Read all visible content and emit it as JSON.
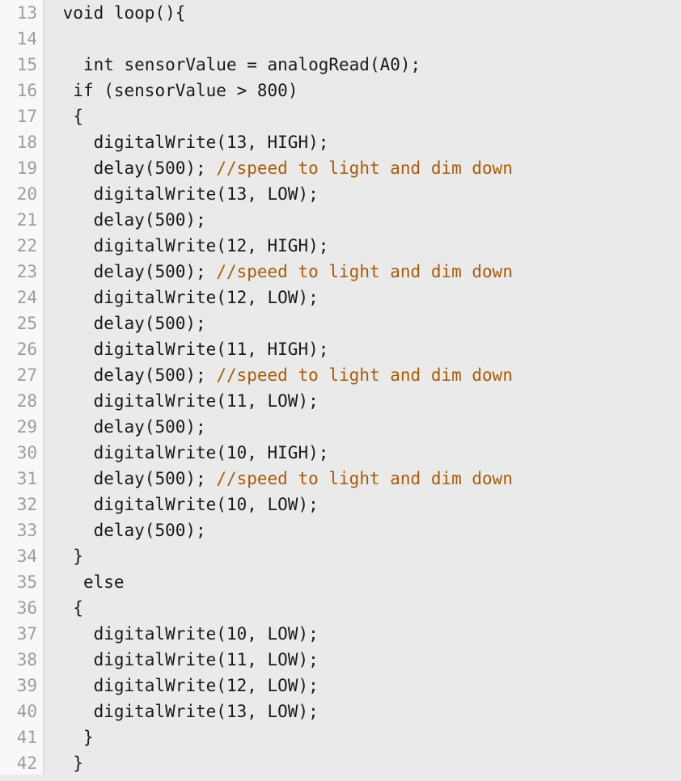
{
  "editor": {
    "app": "arduino-ide-code-editor",
    "language": "cpp",
    "first_line_number": 13,
    "last_line_number": 42,
    "colors": {
      "gutter_background": "#f8f8f8",
      "gutter_text": "#9d9d9d",
      "code_background": "#eaeaea",
      "plain_text": "#1a1a1a",
      "keyword": "#7b1fa2",
      "number": "#1a7052",
      "comment": "#a85c08",
      "bottom_bar": "#dfe3e8"
    }
  },
  "line_numbers": [
    "13",
    "14",
    "15",
    "16",
    "17",
    "18",
    "19",
    "20",
    "21",
    "22",
    "23",
    "24",
    "25",
    "26",
    "27",
    "28",
    "29",
    "30",
    "31",
    "32",
    "33",
    "34",
    "35",
    "36",
    "37",
    "38",
    "39",
    "40",
    "41",
    "42"
  ],
  "lines": [
    {
      "number": "13",
      "text": " void loop(){",
      "tokens": [
        {
          "t": " ",
          "c": "plain"
        },
        {
          "t": "void",
          "c": "keyword"
        },
        {
          "t": " loop(){",
          "c": "plain"
        }
      ]
    },
    {
      "number": "14",
      "text": "",
      "tokens": []
    },
    {
      "number": "15",
      "text": "   int sensorValue = analogRead(A0);",
      "tokens": [
        {
          "t": "   ",
          "c": "plain"
        },
        {
          "t": "int",
          "c": "keyword"
        },
        {
          "t": " sensorValue = analogRead(A0);",
          "c": "plain"
        }
      ]
    },
    {
      "number": "16",
      "text": "  if (sensorValue > 800)",
      "tokens": [
        {
          "t": "  ",
          "c": "plain"
        },
        {
          "t": "if",
          "c": "keyword"
        },
        {
          "t": " (sensorValue > ",
          "c": "plain"
        },
        {
          "t": "800",
          "c": "number"
        },
        {
          "t": ")",
          "c": "plain"
        }
      ]
    },
    {
      "number": "17",
      "text": "  {",
      "tokens": [
        {
          "t": "  {",
          "c": "plain"
        }
      ]
    },
    {
      "number": "18",
      "text": "    digitalWrite(13, HIGH);",
      "tokens": [
        {
          "t": "    digitalWrite(",
          "c": "plain"
        },
        {
          "t": "13",
          "c": "number"
        },
        {
          "t": ", HIGH);",
          "c": "plain"
        }
      ]
    },
    {
      "number": "19",
      "text": "    delay(500); //speed to light and dim down",
      "tokens": [
        {
          "t": "    delay(",
          "c": "plain"
        },
        {
          "t": "500",
          "c": "number"
        },
        {
          "t": "); ",
          "c": "plain"
        },
        {
          "t": "//speed to light and dim down",
          "c": "comment"
        }
      ]
    },
    {
      "number": "20",
      "text": "    digitalWrite(13, LOW);",
      "tokens": [
        {
          "t": "    digitalWrite(",
          "c": "plain"
        },
        {
          "t": "13",
          "c": "number"
        },
        {
          "t": ", LOW);",
          "c": "plain"
        }
      ]
    },
    {
      "number": "21",
      "text": "    delay(500);",
      "tokens": [
        {
          "t": "    delay(",
          "c": "plain"
        },
        {
          "t": "500",
          "c": "number"
        },
        {
          "t": ");",
          "c": "plain"
        }
      ]
    },
    {
      "number": "22",
      "text": "    digitalWrite(12, HIGH);",
      "tokens": [
        {
          "t": "    digitalWrite(",
          "c": "plain"
        },
        {
          "t": "12",
          "c": "number"
        },
        {
          "t": ", HIGH);",
          "c": "plain"
        }
      ]
    },
    {
      "number": "23",
      "text": "    delay(500); //speed to light and dim down",
      "tokens": [
        {
          "t": "    delay(",
          "c": "plain"
        },
        {
          "t": "500",
          "c": "number"
        },
        {
          "t": "); ",
          "c": "plain"
        },
        {
          "t": "//speed to light and dim down",
          "c": "comment"
        }
      ]
    },
    {
      "number": "24",
      "text": "    digitalWrite(12, LOW);",
      "tokens": [
        {
          "t": "    digitalWrite(",
          "c": "plain"
        },
        {
          "t": "12",
          "c": "number"
        },
        {
          "t": ", LOW);",
          "c": "plain"
        }
      ]
    },
    {
      "number": "25",
      "text": "    delay(500);",
      "tokens": [
        {
          "t": "    delay(",
          "c": "plain"
        },
        {
          "t": "500",
          "c": "number"
        },
        {
          "t": ");",
          "c": "plain"
        }
      ]
    },
    {
      "number": "26",
      "text": "    digitalWrite(11, HIGH);",
      "tokens": [
        {
          "t": "    digitalWrite(",
          "c": "plain"
        },
        {
          "t": "11",
          "c": "number"
        },
        {
          "t": ", HIGH);",
          "c": "plain"
        }
      ]
    },
    {
      "number": "27",
      "text": "    delay(500); //speed to light and dim down",
      "tokens": [
        {
          "t": "    delay(",
          "c": "plain"
        },
        {
          "t": "500",
          "c": "number"
        },
        {
          "t": "); ",
          "c": "plain"
        },
        {
          "t": "//speed to light and dim down",
          "c": "comment"
        }
      ]
    },
    {
      "number": "28",
      "text": "    digitalWrite(11, LOW);",
      "tokens": [
        {
          "t": "    digitalWrite(",
          "c": "plain"
        },
        {
          "t": "11",
          "c": "number"
        },
        {
          "t": ", LOW);",
          "c": "plain"
        }
      ]
    },
    {
      "number": "29",
      "text": "    delay(500);",
      "tokens": [
        {
          "t": "    delay(",
          "c": "plain"
        },
        {
          "t": "500",
          "c": "number"
        },
        {
          "t": ");",
          "c": "plain"
        }
      ]
    },
    {
      "number": "30",
      "text": "    digitalWrite(10, HIGH);",
      "tokens": [
        {
          "t": "    digitalWrite(",
          "c": "plain"
        },
        {
          "t": "10",
          "c": "number"
        },
        {
          "t": ", HIGH);",
          "c": "plain"
        }
      ]
    },
    {
      "number": "31",
      "text": "    delay(500); //speed to light and dim down",
      "tokens": [
        {
          "t": "    delay(",
          "c": "plain"
        },
        {
          "t": "500",
          "c": "number"
        },
        {
          "t": "); ",
          "c": "plain"
        },
        {
          "t": "//speed to light and dim down",
          "c": "comment"
        }
      ]
    },
    {
      "number": "32",
      "text": "    digitalWrite(10, LOW);",
      "tokens": [
        {
          "t": "    digitalWrite(",
          "c": "plain"
        },
        {
          "t": "10",
          "c": "number"
        },
        {
          "t": ", LOW);",
          "c": "plain"
        }
      ]
    },
    {
      "number": "33",
      "text": "    delay(500);",
      "tokens": [
        {
          "t": "    delay(",
          "c": "plain"
        },
        {
          "t": "500",
          "c": "number"
        },
        {
          "t": ");",
          "c": "plain"
        }
      ]
    },
    {
      "number": "34",
      "text": "  }",
      "tokens": [
        {
          "t": "  }",
          "c": "plain"
        }
      ]
    },
    {
      "number": "35",
      "text": "   else",
      "tokens": [
        {
          "t": "   ",
          "c": "plain"
        },
        {
          "t": "else",
          "c": "keyword"
        }
      ]
    },
    {
      "number": "36",
      "text": "  {",
      "tokens": [
        {
          "t": "  {",
          "c": "plain"
        }
      ]
    },
    {
      "number": "37",
      "text": "    digitalWrite(10, LOW);",
      "tokens": [
        {
          "t": "    digitalWrite(",
          "c": "plain"
        },
        {
          "t": "10",
          "c": "number"
        },
        {
          "t": ", LOW);",
          "c": "plain"
        }
      ]
    },
    {
      "number": "38",
      "text": "    digitalWrite(11, LOW);",
      "tokens": [
        {
          "t": "    digitalWrite(",
          "c": "plain"
        },
        {
          "t": "11",
          "c": "number"
        },
        {
          "t": ", LOW);",
          "c": "plain"
        }
      ]
    },
    {
      "number": "39",
      "text": "    digitalWrite(12, LOW);",
      "tokens": [
        {
          "t": "    digitalWrite(",
          "c": "plain"
        },
        {
          "t": "12",
          "c": "number"
        },
        {
          "t": ", LOW);",
          "c": "plain"
        }
      ]
    },
    {
      "number": "40",
      "text": "    digitalWrite(13, LOW);",
      "tokens": [
        {
          "t": "    digitalWrite(",
          "c": "plain"
        },
        {
          "t": "13",
          "c": "number"
        },
        {
          "t": ", LOW);",
          "c": "plain"
        }
      ]
    },
    {
      "number": "41",
      "text": "   }",
      "tokens": [
        {
          "t": "   }",
          "c": "plain"
        }
      ]
    },
    {
      "number": "42",
      "text": "  }",
      "tokens": [
        {
          "t": "  }",
          "c": "plain"
        }
      ]
    }
  ]
}
